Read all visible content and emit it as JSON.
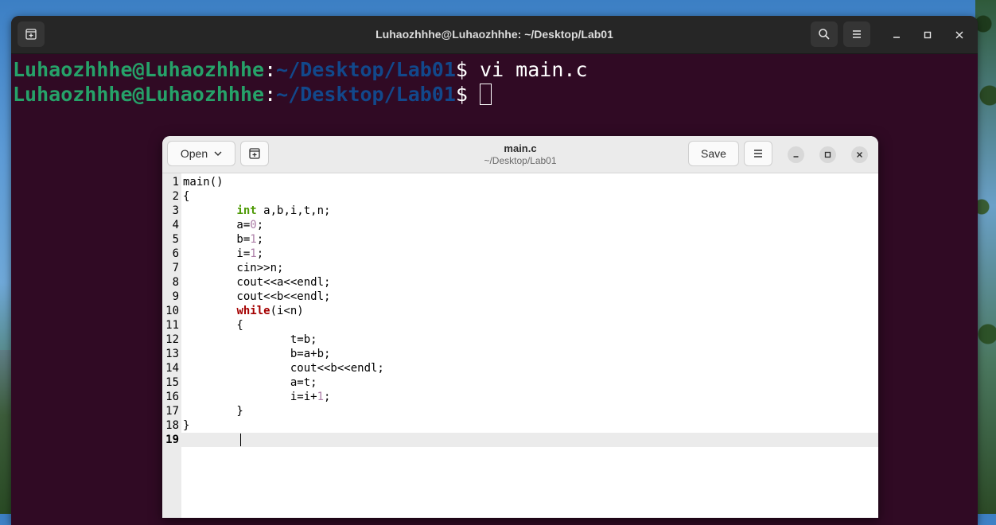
{
  "terminal": {
    "title": "Luhaozhhhe@Luhaozhhhe: ~/Desktop/Lab01",
    "prompt_user": "Luhaozhhhe@Luhaozhhhe",
    "prompt_sep": ":",
    "prompt_path": "~/Desktop/Lab01",
    "prompt_symbol": "$ ",
    "lines": [
      {
        "command": "vi main.c"
      },
      {
        "command": ""
      }
    ]
  },
  "editor": {
    "open_label": "Open",
    "save_label": "Save",
    "title": "main.c",
    "subtitle": "~/Desktop/Lab01",
    "code_lines": [
      [
        {
          "t": "main()"
        }
      ],
      [
        {
          "t": "{"
        }
      ],
      [
        {
          "t": "        "
        },
        {
          "t": "int",
          "c": "kw-type"
        },
        {
          "t": " a,b,i,t,n;"
        }
      ],
      [
        {
          "t": "        a="
        },
        {
          "t": "0",
          "c": "num"
        },
        {
          "t": ";"
        }
      ],
      [
        {
          "t": "        b="
        },
        {
          "t": "1",
          "c": "num"
        },
        {
          "t": ";"
        }
      ],
      [
        {
          "t": "        i="
        },
        {
          "t": "1",
          "c": "num"
        },
        {
          "t": ";"
        }
      ],
      [
        {
          "t": "        cin>>n;"
        }
      ],
      [
        {
          "t": "        cout<<a<<endl;"
        }
      ],
      [
        {
          "t": "        cout<<b<<endl;"
        }
      ],
      [
        {
          "t": "        "
        },
        {
          "t": "while",
          "c": "kw-ctrl"
        },
        {
          "t": "(i<n)"
        }
      ],
      [
        {
          "t": "        {"
        }
      ],
      [
        {
          "t": "                t=b;"
        }
      ],
      [
        {
          "t": "                b=a+b;"
        }
      ],
      [
        {
          "t": "                cout<<b<<endl;"
        }
      ],
      [
        {
          "t": "                a=t;"
        }
      ],
      [
        {
          "t": "                i=i+"
        },
        {
          "t": "1",
          "c": "num"
        },
        {
          "t": ";"
        }
      ],
      [
        {
          "t": "        }"
        }
      ],
      [
        {
          "t": "}"
        }
      ],
      [
        {
          "t": ""
        }
      ]
    ],
    "current_line": 19
  },
  "icons": {
    "new_tab": "new-tab-icon",
    "search": "search-icon",
    "menu": "hamburger-menu-icon",
    "minimize": "minimize-icon",
    "maximize": "maximize-icon",
    "close": "close-icon",
    "dropdown": "chevron-down-icon"
  },
  "colors": {
    "terminal_bg": "#300a24",
    "prompt_user": "#26a269",
    "prompt_path": "#12488b",
    "keyword_type": "#4e9a06",
    "keyword_control": "#a40000",
    "number": "#ad7fa8"
  }
}
